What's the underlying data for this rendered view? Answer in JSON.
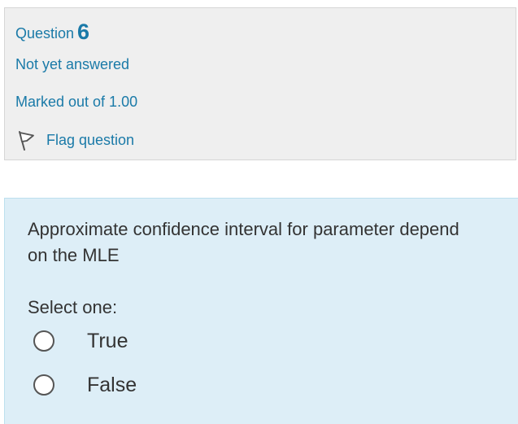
{
  "question_info": {
    "label": "Question",
    "number": "6",
    "state": "Not yet answered",
    "grade": "Marked out of 1.00",
    "flag_label": "Flag question",
    "flag_icon": "flag-icon"
  },
  "question": {
    "text": "Approximate confidence interval for parameter depend on the MLE",
    "prompt": "Select one:",
    "options": [
      {
        "label": "True",
        "selected": false
      },
      {
        "label": "False",
        "selected": false
      }
    ]
  },
  "colors": {
    "info_bg": "#efefef",
    "info_text": "#1a7aa8",
    "content_bg": "#ddeef7",
    "body_text": "#333333"
  }
}
